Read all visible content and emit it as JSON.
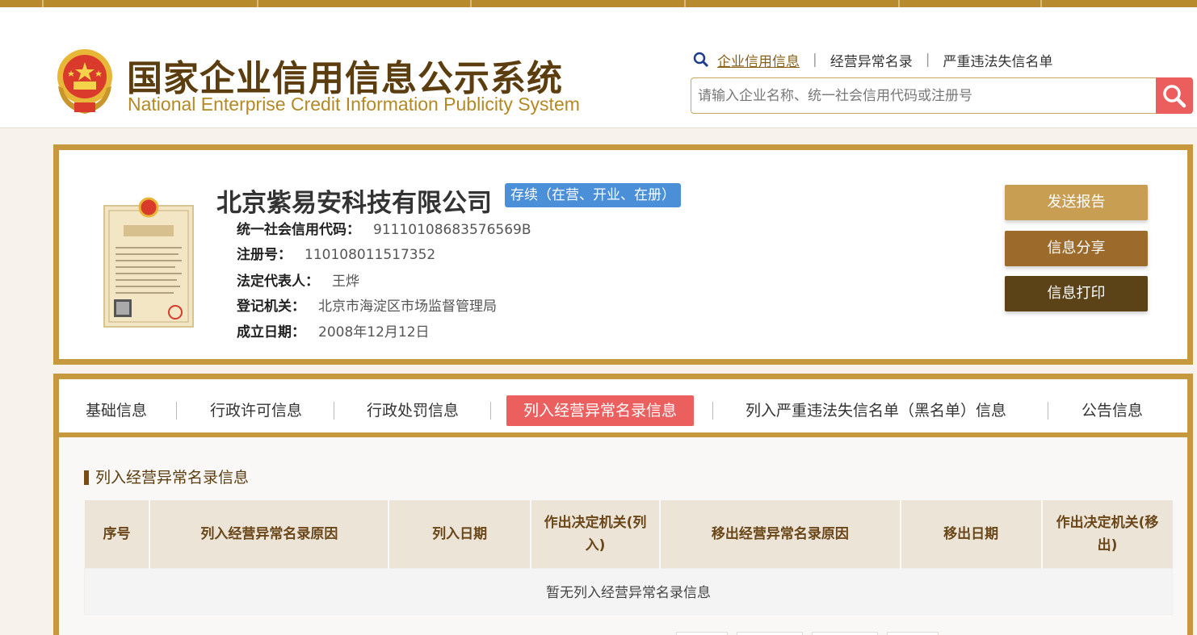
{
  "header": {
    "logo_cn": "国家企业信用信息公示系统",
    "logo_en": "National Enterprise Credit Information Publicity System",
    "links": [
      "企业信用信息",
      "经营异常名录",
      "严重违法失信名单"
    ],
    "search_placeholder": "请输入企业名称、统一社会信用代码或注册号"
  },
  "company": {
    "name": "北京紫易安科技有限公司",
    "status": "存续（在营、开业、在册）",
    "fields": [
      {
        "label": "统一社会信用代码：",
        "value": "91110108683576569B"
      },
      {
        "label": "注册号：",
        "value": "110108011517352"
      },
      {
        "label": "法定代表人：",
        "value": "王烨"
      },
      {
        "label": "登记机关：",
        "value": "北京市海淀区市场监督管理局"
      },
      {
        "label": "成立日期：",
        "value": "2008年12月12日"
      }
    ],
    "license_title": "营业执照"
  },
  "actions": {
    "send": "发送报告",
    "share": "信息分享",
    "print": "信息打印"
  },
  "tabs": [
    "基础信息",
    "行政许可信息",
    "行政处罚信息",
    "列入经营异常名录信息",
    "列入严重违法失信名单（黑名单）信息",
    "公告信息"
  ],
  "section": {
    "title": "列入经营异常名录信息",
    "columns": [
      "序号",
      "列入经营异常名录原因",
      "列入日期",
      "作出决定机关(列入)",
      "移出经营异常名录原因",
      "移出日期",
      "作出决定机关(移出)"
    ],
    "empty_text": "暂无列入经营异常名录信息"
  },
  "colors": {
    "gold_border": "#c6993f",
    "active_tab": "#ec5f5f",
    "status_badge": "#4a8fd8",
    "search_button": "#ec5d5d"
  }
}
